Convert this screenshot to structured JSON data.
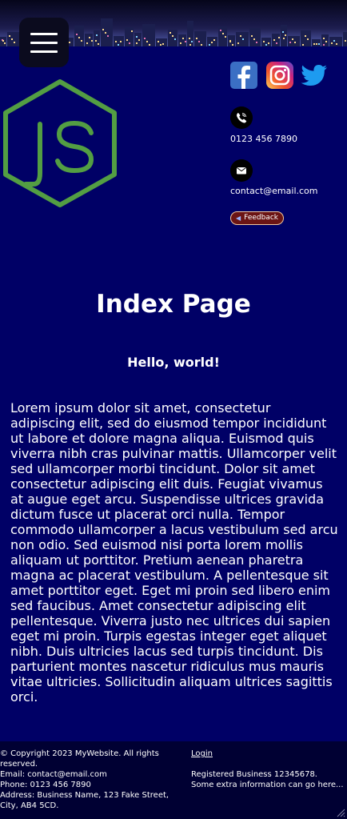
{
  "header": {
    "menu_icon": "hamburger-menu-icon",
    "logo_icon": "nodejs-hexagon-logo"
  },
  "social": {
    "facebook_icon": "facebook-icon",
    "instagram_icon": "instagram-icon",
    "twitter_icon": "twitter-icon"
  },
  "contact": {
    "phone": "0123 456 7890",
    "phone_icon": "phone-icon",
    "email": "contact@email.com",
    "email_icon": "email-icon"
  },
  "feedback_label": "Feedback",
  "main": {
    "title": "Index Page",
    "subtitle": "Hello, world!",
    "body": "Lorem ipsum dolor sit amet, consectetur adipiscing elit, sed do eiusmod tempor incididunt ut labore et dolore magna aliqua. Euismod quis viverra nibh cras pulvinar mattis. Ullamcorper velit sed ullamcorper morbi tincidunt. Dolor sit amet consectetur adipiscing elit duis. Feugiat vivamus at augue eget arcu. Suspendisse ultrices gravida dictum fusce ut placerat orci nulla. Tempor commodo ullamcorper a lacus vestibulum sed arcu non odio. Sed euismod nisi porta lorem mollis aliquam ut porttitor. Pretium aenean pharetra magna ac placerat vestibulum. A pellentesque sit amet porttitor eget. Eget mi proin sed libero enim sed faucibus. Amet consectetur adipiscing elit pellentesque. Viverra justo nec ultrices dui sapien eget mi proin. Turpis egestas integer eget aliquet nibh. Duis ultricies lacus sed turpis tincidunt. Dis parturient montes nascetur ridiculus mus mauris vitae ultricies. Sollicitudin aliquam ultrices sagittis orci."
  },
  "footer": {
    "copyright": "© Copyright 2023 MyWebsite. All rights reserved.",
    "email": "Email: contact@email.com",
    "phone": "Phone: 0123 456 7890",
    "address": "Address: Business Name, 123 Fake Street, City, AB4 5CD.",
    "login": "Login",
    "registered": "Registered Business 12345678.",
    "extra": "Some extra information can go here..."
  },
  "colors": {
    "background": "#000066",
    "footer_background": "#000033",
    "logo_green": "#539e43",
    "twitter_blue": "#1d9bf0",
    "facebook_blue": "#1877f2"
  }
}
